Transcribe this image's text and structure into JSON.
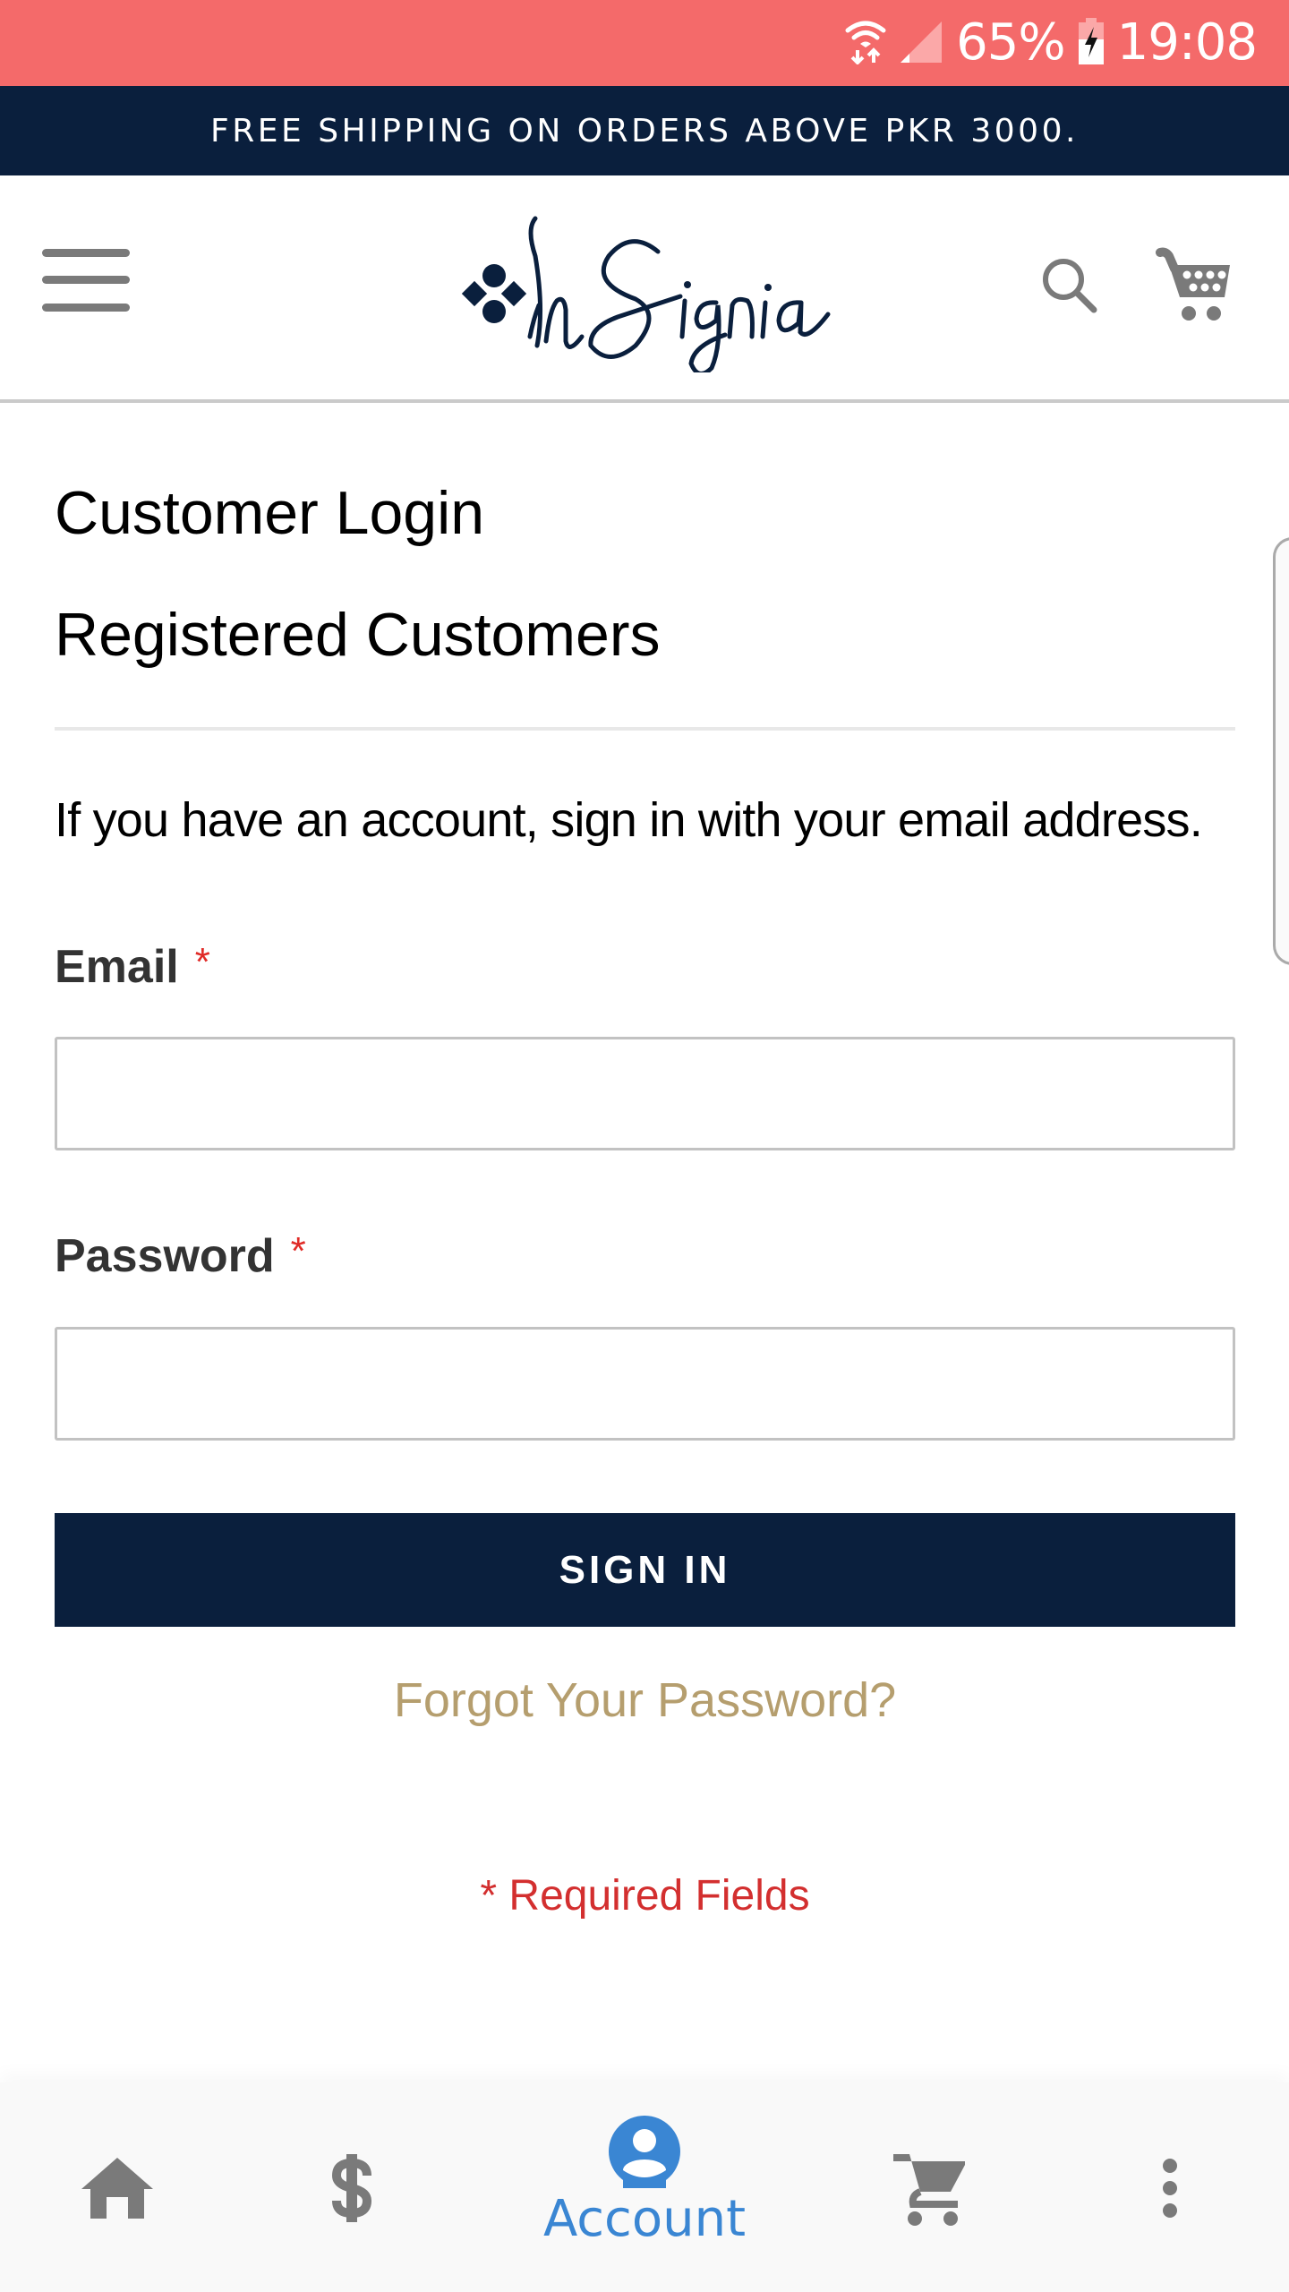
{
  "status_bar": {
    "battery_percent": "65%",
    "time": "19:08",
    "icons": [
      "wifi-data-icon",
      "cellular-signal-icon",
      "battery-charging-icon"
    ]
  },
  "promo": {
    "text": "FREE SHIPPING ON ORDERS ABOVE PKR 3000."
  },
  "header": {
    "logo_text": "InSignia",
    "menu_icon": "hamburger-menu-icon",
    "search_icon": "search-icon",
    "cart_icon": "shopping-cart-icon"
  },
  "main": {
    "page_title": "Customer Login",
    "block_title": "Registered Customers",
    "intro": "If you have an account, sign in with your email address.",
    "email": {
      "label": "Email",
      "required_mark": "*",
      "value": "",
      "placeholder": ""
    },
    "password": {
      "label": "Password",
      "required_mark": "*",
      "value": "",
      "placeholder": ""
    },
    "sign_in_label": "SIGN IN",
    "forgot_password_label": "Forgot Your Password?",
    "required_note": "* Required Fields"
  },
  "bottom_nav": {
    "items": [
      {
        "icon": "home-icon",
        "label": ""
      },
      {
        "icon": "dollar-icon",
        "label": ""
      },
      {
        "icon": "account-circle-icon",
        "label": "Account",
        "active": true
      },
      {
        "icon": "cart-icon",
        "label": ""
      },
      {
        "icon": "more-vertical-icon",
        "label": ""
      }
    ]
  },
  "colors": {
    "status_bar": "#F46A6A",
    "navy": "#0A1F3D",
    "gold_link": "#B59E6E",
    "required_red": "#D32F2F",
    "active_blue": "#3A86D3",
    "icon_gray": "#7A7A7A"
  }
}
